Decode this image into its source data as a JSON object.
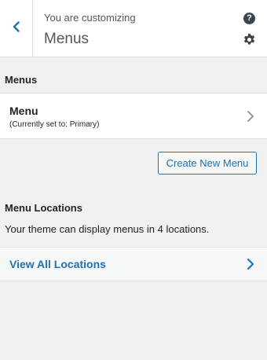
{
  "header": {
    "subtitle": "You are customizing",
    "title": "Menus",
    "help_glyph": "?"
  },
  "section": {
    "heading": "Menus"
  },
  "menu_item": {
    "name": "Menu",
    "status": "(Currently set to: Primary)"
  },
  "create_button": {
    "label": "Create New Menu"
  },
  "locations": {
    "heading": "Menu Locations",
    "description": "Your theme can display menus in 4 locations.",
    "view_all_label": "View All Locations"
  },
  "icons": {
    "back": "chevron-left-icon",
    "help": "help-icon",
    "settings": "gear-icon",
    "menu_chevron": "chevron-right-icon",
    "view_all_chevron": "chevron-right-icon"
  },
  "colors": {
    "accent": "#2271b1",
    "background": "#f0f0f1",
    "card": "#ffffff",
    "text": "#1d2327",
    "muted_text": "#50575e",
    "border": "#dcdcde"
  }
}
